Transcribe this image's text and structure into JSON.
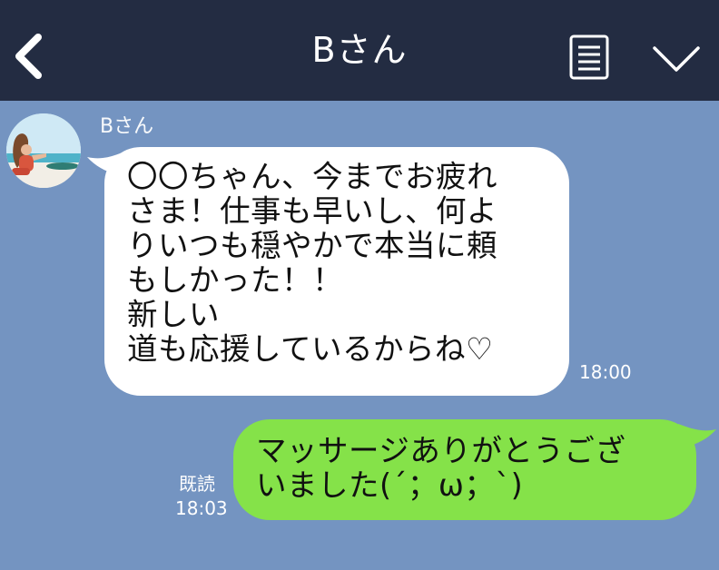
{
  "header": {
    "title": "Bさん",
    "back_icon": "chevron-left-icon",
    "menu_icon": "notes-icon",
    "expand_icon": "chevron-down-icon",
    "background": "#232c42"
  },
  "chat": {
    "background": "#7494c1",
    "messages": [
      {
        "direction": "incoming",
        "sender": "Bさん",
        "text": "〇〇ちゃん、今までお疲れ\nさま！仕事も早いし、何よ\nりいつも穏やかで本当に頼\nもしかった！！\n新しい\n道も応援しているからね♡",
        "time": "18:00",
        "bubble_color": "#ffffff"
      },
      {
        "direction": "outgoing",
        "text": "マッサージありがとうござ\nいました(´；ω；`)",
        "read": "既読",
        "time": "18:03",
        "bubble_color": "#85e249"
      }
    ]
  }
}
